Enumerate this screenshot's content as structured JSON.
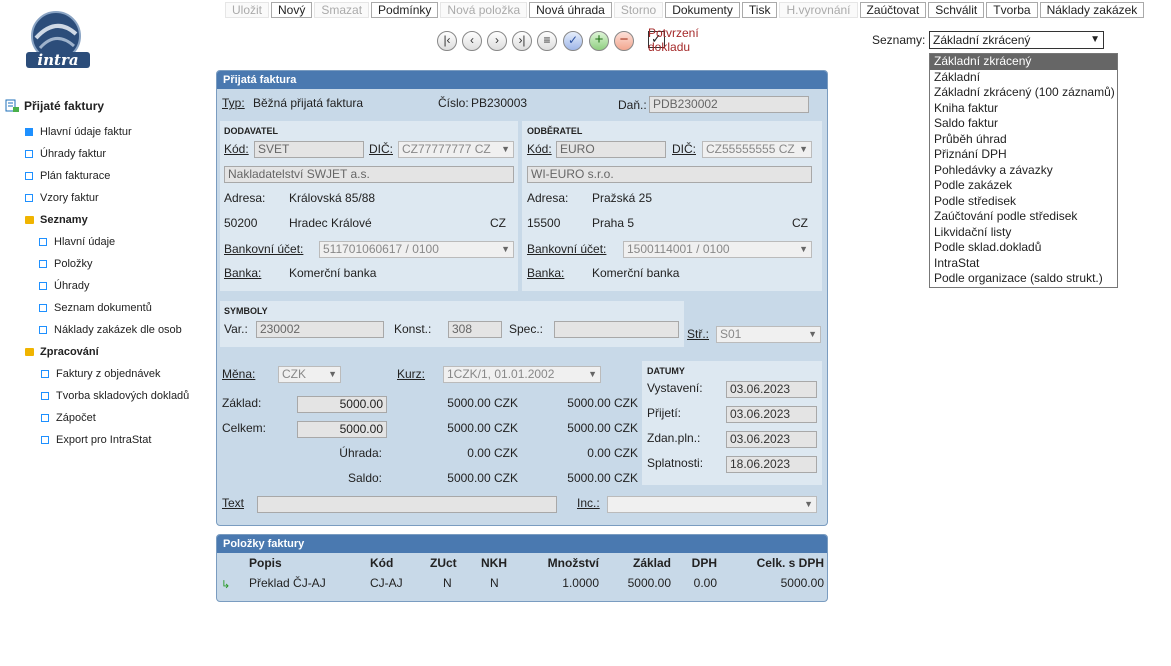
{
  "toolbar": {
    "buttons": [
      {
        "label": "Uložit",
        "enabled": false
      },
      {
        "label": "Nový",
        "enabled": true
      },
      {
        "label": "Smazat",
        "enabled": false
      },
      {
        "label": "Podmínky",
        "enabled": true
      },
      {
        "label": "Nová položka",
        "enabled": false
      },
      {
        "label": "Nová úhrada",
        "enabled": true
      },
      {
        "label": "Storno",
        "enabled": false
      },
      {
        "label": "Dokumenty",
        "enabled": true
      },
      {
        "label": "Tisk",
        "enabled": true
      },
      {
        "label": "H.vyrovnání",
        "enabled": false
      },
      {
        "label": "Zaúčtovat",
        "enabled": true
      },
      {
        "label": "Schválit",
        "enabled": true
      },
      {
        "label": "Tvorba",
        "enabled": true
      },
      {
        "label": "Náklady zakázek",
        "enabled": true
      }
    ]
  },
  "nav": {
    "confirm_label": "Potvrzení dokladu",
    "confirm_checked": true
  },
  "seznamy": {
    "label": "Seznamy:",
    "selected": "Základní zkrácený",
    "options": [
      "Základní zkrácený",
      "Základní",
      "Základní zkrácený (100 záznamů)",
      "Kniha faktur",
      "Saldo faktur",
      "Průběh úhrad",
      "Přiznání DPH",
      "Pohledávky a závazky",
      "Podle zakázek",
      "Podle středisek",
      "Zaúčtování podle středisek",
      "Likvidační listy",
      "Podle sklad.dokladů",
      "IntraStat",
      "Podle organizace (saldo strukt.)"
    ]
  },
  "sidebar": {
    "title": "Přijaté faktury",
    "items": [
      {
        "label": "Hlavní údaje faktur",
        "kind": "filled"
      },
      {
        "label": "Úhrady faktur",
        "kind": "square"
      },
      {
        "label": "Plán fakturace",
        "kind": "square"
      },
      {
        "label": "Vzory faktur",
        "kind": "square"
      },
      {
        "label": "Seznamy",
        "kind": "folder"
      },
      {
        "label": "Hlavní údaje",
        "kind": "square"
      },
      {
        "label": "Položky",
        "kind": "square"
      },
      {
        "label": "Úhrady",
        "kind": "square"
      },
      {
        "label": "Seznam dokumentů",
        "kind": "square"
      },
      {
        "label": "Náklady zakázek dle osob",
        "kind": "square"
      },
      {
        "label": "Zpracování",
        "kind": "folder"
      },
      {
        "label": "Faktury z objednávek",
        "kind": "square"
      },
      {
        "label": "Tvorba skladových dokladů",
        "kind": "square"
      },
      {
        "label": "Zápočet",
        "kind": "square"
      },
      {
        "label": "Export pro IntraStat",
        "kind": "square"
      }
    ]
  },
  "invoice": {
    "panel_title": "Přijatá faktura",
    "typ_label": "Typ:",
    "typ_value": "Běžná přijatá faktura",
    "cislo_label": "Číslo:",
    "cislo_value": "PB230003",
    "dan_label": "Daň.:",
    "dan_value": "PDB230002",
    "supplier": {
      "section": "DODAVATEL",
      "kod_label": "Kód:",
      "kod_value": "SVET",
      "dic_label": "DIČ:",
      "dic_value": "CZ77777777 CZ",
      "name": "Nakladatelství SWJET a.s.",
      "adresa_label": "Adresa:",
      "street": "Královská 85/88",
      "zip": "50200",
      "city": "Hradec Králové",
      "country": "CZ",
      "bank_account_label": "Bankovní účet:",
      "bank_account": "511701060617 / 0100",
      "bank_label": "Banka:",
      "bank": "Komerční banka"
    },
    "customer": {
      "section": "ODBĚRATEL",
      "kod_label": "Kód:",
      "kod_value": "EURO",
      "dic_label": "DIČ:",
      "dic_value": "CZ55555555 CZ",
      "name": "WI-EURO s.r.o.",
      "adresa_label": "Adresa:",
      "street": "Pražská 25",
      "zip": "15500",
      "city": "Praha 5",
      "country": "CZ",
      "bank_account_label": "Bankovní účet:",
      "bank_account": "1500114001 / 0100",
      "bank_label": "Banka:",
      "bank": "Komerční banka"
    },
    "symbols": {
      "section": "SYMBOLY",
      "var_label": "Var.:",
      "var_value": "230002",
      "konst_label": "Konst.:",
      "konst_value": "308",
      "spec_label": "Spec.:",
      "spec_value": "",
      "str_label": "Stř.:",
      "str_value": "S01"
    },
    "amounts": {
      "mena_label": "Měna:",
      "mena_value": "CZK",
      "kurz_label": "Kurz:",
      "kurz_value": "1CZK/1,   01.01.2002",
      "zaklad_label": "Základ:",
      "zaklad_input": "5000.00",
      "zaklad_a": "5000.00 CZK",
      "zaklad_b": "5000.00 CZK",
      "celkem_label": "Celkem:",
      "celkem_input": "5000.00",
      "celkem_a": "5000.00 CZK",
      "celkem_b": "5000.00 CZK",
      "uhrada_label": "Úhrada:",
      "uhrada_a": "0.00 CZK",
      "uhrada_b": "0.00 CZK",
      "saldo_label": "Saldo:",
      "saldo_a": "5000.00 CZK",
      "saldo_b": "5000.00 CZK"
    },
    "dates": {
      "section": "DATUMY",
      "vystaveni_label": "Vystavení:",
      "vystaveni": "03.06.2023",
      "prijeti_label": "Přijetí:",
      "prijeti": "03.06.2023",
      "zdan_label": "Zdan.pln.:",
      "zdan": "03.06.2023",
      "splatnosti_label": "Splatnosti:",
      "splatnosti": "18.06.2023"
    },
    "text_label": "Text",
    "text_value": "",
    "inc_label": "Inc.:",
    "inc_value": ""
  },
  "items": {
    "panel_title": "Položky faktury",
    "headers": [
      "Popis",
      "Kód",
      "ZUct",
      "NKH",
      "Množství",
      "Základ",
      "DPH",
      "Celk. s DPH"
    ],
    "rows": [
      [
        "Překlad ČJ-AJ",
        "CJ-AJ",
        "N",
        "N",
        "1.0000",
        "5000.00",
        "0.00",
        "5000.00"
      ]
    ]
  },
  "colors": {
    "panel_header": "#4a79b0",
    "panel_bg": "#c8d9e8",
    "inner_bg": "#dde8f1",
    "confirm_text": "#a52a2a",
    "sidebar_icon": "#1e90ff",
    "folder": "#f0b400"
  }
}
